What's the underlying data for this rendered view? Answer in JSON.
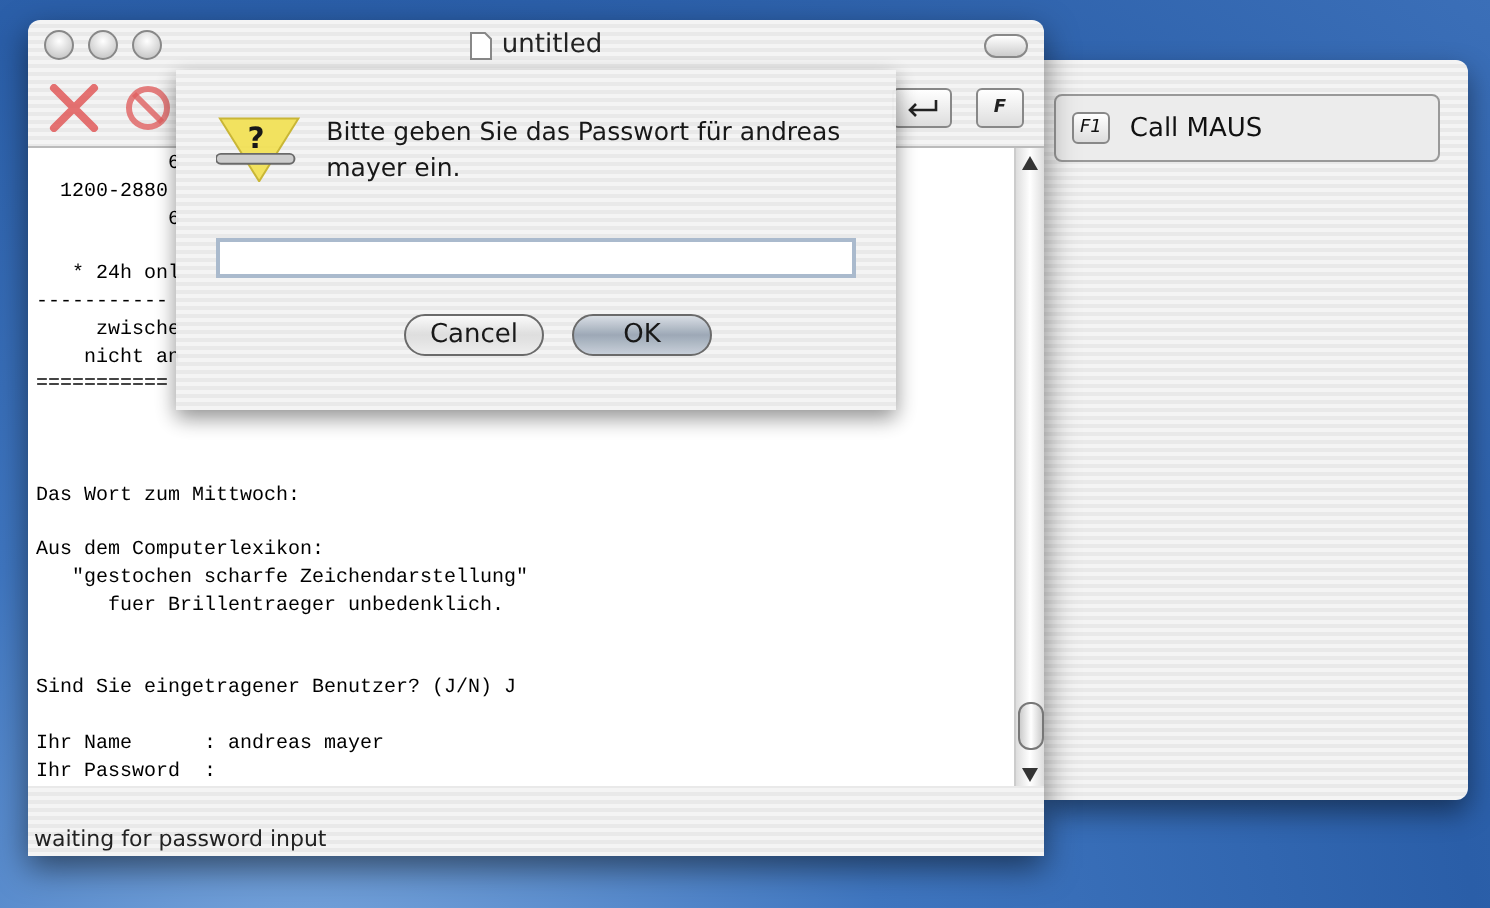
{
  "window": {
    "title": "untitled"
  },
  "toolbar": {
    "keys": [
      {
        "kind": "return"
      },
      {
        "kind": "letter",
        "label": "F"
      }
    ]
  },
  "terminal": {
    "blocks": [
      {
        "lines": [
          "           6",
          "  1200-2880",
          "           6"
        ]
      },
      {
        "lines": [
          "   * 24h onl",
          "-----------",
          "     zwische",
          "    nicht an",
          "==========="
        ]
      },
      {
        "lines": [
          "Das Wort zum Mittwoch:"
        ]
      },
      {
        "lines": [
          "Aus dem Computerlexikon:",
          "   \"gestochen scharfe Zeichendarstellung\"",
          "      fuer Brillentraeger unbedenklich."
        ]
      },
      {
        "lines": [
          "Sind Sie eingetragener Benutzer? (J/N) J"
        ]
      },
      {
        "lines": [
          "Ihr Name      : andreas mayer",
          "Ihr Password  :"
        ]
      }
    ]
  },
  "status_bar": "waiting for password input",
  "dialog": {
    "icon_glyph": "?",
    "message": "Bitte geben Sie das Passwort für andreas mayer ein.",
    "buttons": [
      {
        "label": "Cancel",
        "default": false
      },
      {
        "label": "OK",
        "default": true
      }
    ]
  },
  "drawer": {
    "items": [
      {
        "key": "F1",
        "label": "Call MAUS"
      }
    ]
  }
}
